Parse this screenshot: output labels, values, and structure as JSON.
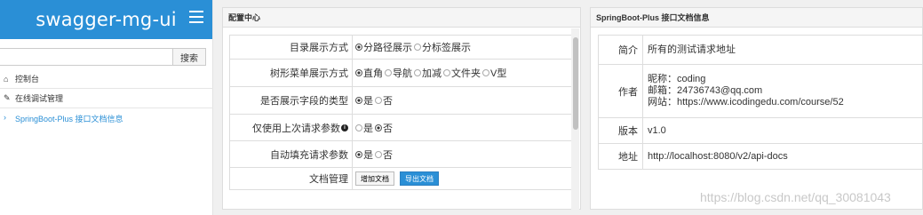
{
  "sidebar": {
    "title": "swagger-mg-ui",
    "search_value": "",
    "search_button": "搜索",
    "items": [
      {
        "icon": "home-icon",
        "glyph": "⌂",
        "label": "控制台"
      },
      {
        "icon": "debug-icon",
        "glyph": "✎",
        "label": "在线调试管理"
      },
      {
        "icon": "chevron-right-icon",
        "glyph": "›",
        "label": "SpringBoot-Plus 接口文档信息"
      }
    ]
  },
  "config": {
    "title": "配置中心",
    "rows": [
      {
        "key": "目录展示方式",
        "options": [
          {
            "label": "分路径展示",
            "checked": true
          },
          {
            "label": "分标签展示",
            "checked": false
          }
        ]
      },
      {
        "key": "树形菜单展示方式",
        "options": [
          {
            "label": "直角",
            "checked": true
          },
          {
            "label": "导航",
            "checked": false
          },
          {
            "label": "加减",
            "checked": false
          },
          {
            "label": "文件夹",
            "checked": false
          },
          {
            "label": "V型",
            "checked": false
          }
        ]
      },
      {
        "key": "是否展示字段的类型",
        "options": [
          {
            "label": "是",
            "checked": true
          },
          {
            "label": "否",
            "checked": false
          }
        ]
      },
      {
        "key": "仅使用上次请求参数",
        "options": [
          {
            "label": "是",
            "checked": false
          },
          {
            "label": "否",
            "checked": true
          }
        ]
      },
      {
        "key": "自动填充请求参数",
        "options": [
          {
            "label": "是",
            "checked": true
          },
          {
            "label": "否",
            "checked": false
          }
        ]
      },
      {
        "key": "文档管理"
      }
    ],
    "doc_buttons": {
      "add": "增加文档",
      "export": "导出文档"
    }
  },
  "info": {
    "title": "SpringBoot-Plus 接口文档信息",
    "intro_key": "简介",
    "intro_val": "所有的测试请求地址",
    "author_key": "作者",
    "author_lines": [
      "昵称：coding",
      "邮箱：24736743@qq.com",
      "网站：https://www.icodingedu.com/course/52"
    ],
    "version_key": "版本",
    "version_val": "v1.0",
    "address_key": "地址",
    "address_val": "http://localhost:8080/v2/api-docs"
  },
  "watermark": "https://blog.csdn.net/qq_30081043",
  "colors": {
    "accent": "#2a8fd6",
    "panel_border": "#dddddd"
  }
}
